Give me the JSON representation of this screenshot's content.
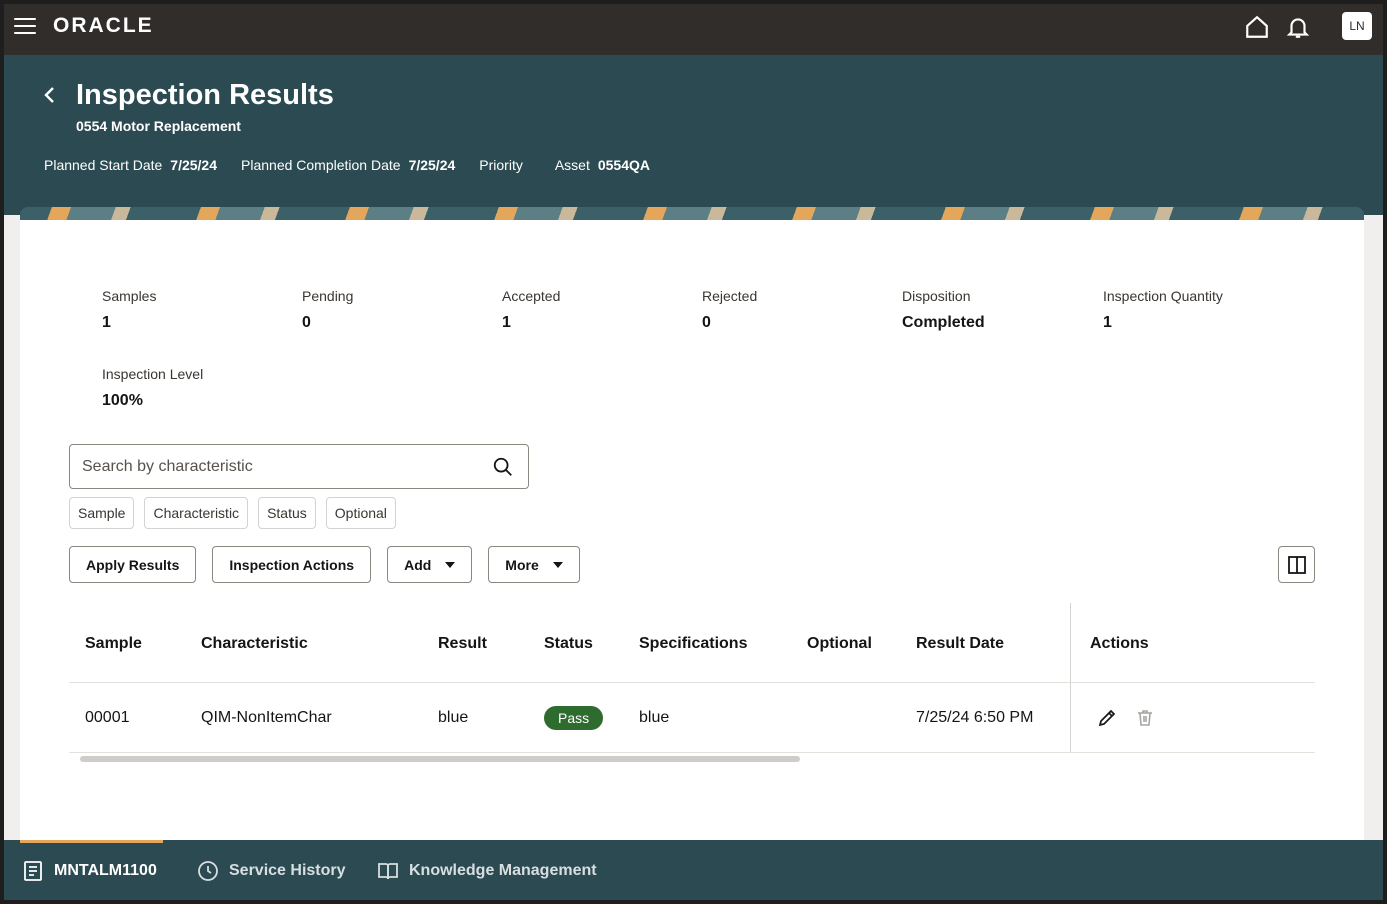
{
  "topbar": {
    "logo": "ORACLE",
    "avatar_initials": "LN"
  },
  "header": {
    "title": "Inspection Results",
    "subtitle": "0554 Motor Replacement",
    "planned_start_label": "Planned Start Date",
    "planned_start_value": "7/25/24",
    "planned_completion_label": "Planned Completion Date",
    "planned_completion_value": "7/25/24",
    "priority_label": "Priority",
    "asset_label": "Asset",
    "asset_value": "0554QA"
  },
  "stats": {
    "samples_label": "Samples",
    "samples_value": "1",
    "pending_label": "Pending",
    "pending_value": "0",
    "accepted_label": "Accepted",
    "accepted_value": "1",
    "rejected_label": "Rejected",
    "rejected_value": "0",
    "disposition_label": "Disposition",
    "disposition_value": "Completed",
    "inspection_quantity_label": "Inspection Quantity",
    "inspection_quantity_value": "1",
    "inspection_level_label": "Inspection Level",
    "inspection_level_value": "100%"
  },
  "search": {
    "placeholder": "Search by characteristic"
  },
  "filter_chips": [
    "Sample",
    "Characteristic",
    "Status",
    "Optional"
  ],
  "toolbar": {
    "apply_results": "Apply Results",
    "inspection_actions": "Inspection Actions",
    "add": "Add",
    "more": "More"
  },
  "table": {
    "columns": [
      "Sample",
      "Characteristic",
      "Result",
      "Status",
      "Specifications",
      "Optional",
      "Result Date",
      "Actions"
    ],
    "rows": [
      {
        "sample": "00001",
        "characteristic": "QIM-NonItemChar",
        "result": "blue",
        "status": "Pass",
        "specifications": "blue",
        "optional": "",
        "result_date": "7/25/24 6:50 PM"
      }
    ]
  },
  "bottom_tabs": {
    "work_order": "MNTALM1100",
    "service_history": "Service History",
    "knowledge_management": "Knowledge Management"
  },
  "colors": {
    "topbar": "#312d2a",
    "header": "#2c4a52",
    "pass_badge": "#2e6b2e",
    "accent": "#e3a65a"
  }
}
